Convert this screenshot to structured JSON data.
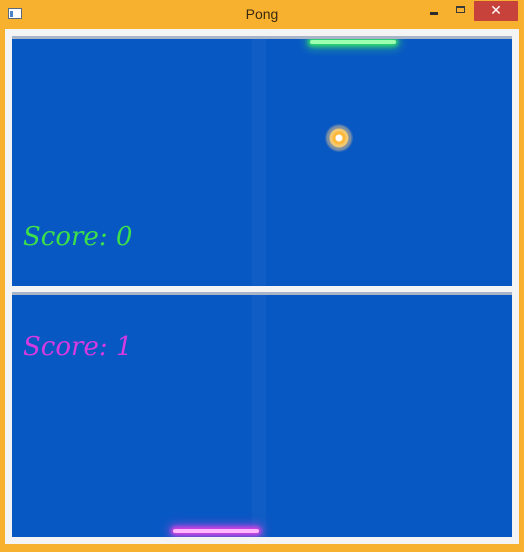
{
  "window": {
    "title": "Pong",
    "controls": {
      "minimize": "minimize",
      "maximize": "maximize",
      "close": "✕"
    }
  },
  "game": {
    "top_panel": {
      "score_text": "Score: 0",
      "paddle_color": "#3ce04a"
    },
    "bottom_panel": {
      "score_text": "Score: 1",
      "paddle_color": "#d83ae2"
    },
    "ball_color": "#ffb838",
    "field_color": "#0858c4"
  }
}
